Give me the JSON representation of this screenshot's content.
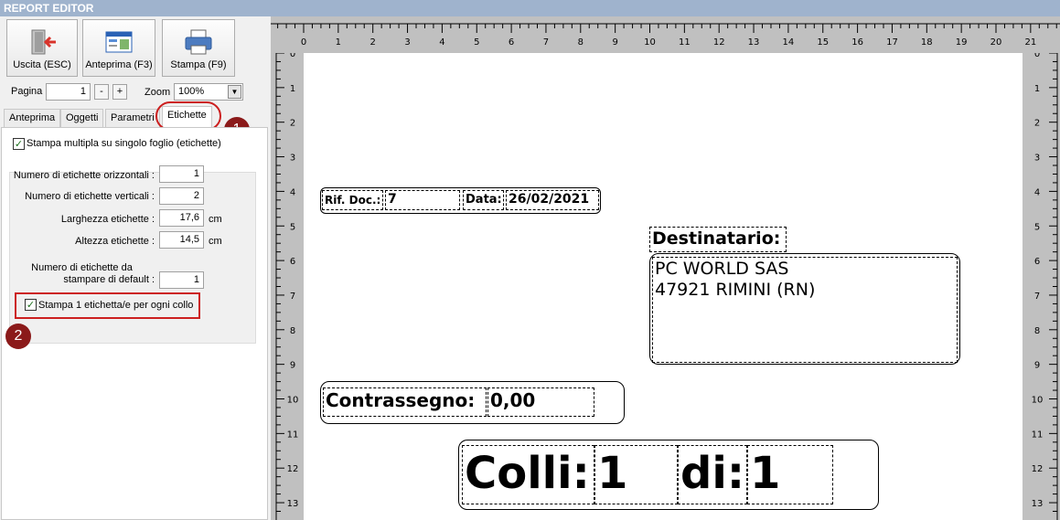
{
  "window": {
    "title": "REPORT EDITOR"
  },
  "toolbar": {
    "exit_label": "Uscita (ESC)",
    "preview_label": "Anteprima (F3)",
    "print_label": "Stampa (F9)"
  },
  "nav": {
    "page_label": "Pagina",
    "page_value": "1",
    "minus": "-",
    "plus": "+",
    "zoom_label": "Zoom",
    "zoom_value": "100%"
  },
  "tabs": [
    {
      "label": "Anteprima"
    },
    {
      "label": "Oggetti"
    },
    {
      "label": "Parametri"
    },
    {
      "label": "Etichette"
    }
  ],
  "etichette": {
    "multi_print_label": "Stampa multipla su singolo foglio (etichette)",
    "multi_print_checked": true,
    "horiz_label": "Numero di etichette orizzontali :",
    "horiz_value": "1",
    "vert_label": "Numero di etichette verticali :",
    "vert_value": "2",
    "width_label": "Larghezza etichette :",
    "width_value": "17,6",
    "width_unit": "cm",
    "height_label": "Altezza etichette :",
    "height_value": "14,5",
    "height_unit": "cm",
    "default_label_1": "Numero di etichette da",
    "default_label_2": "stampare di default :",
    "default_value": "1",
    "per_collo_label": "Stampa 1 etichetta/e per ogni collo",
    "per_collo_checked": true
  },
  "callouts": {
    "one": "1",
    "two": "2"
  },
  "ruler": {
    "top_numbers": [
      "0",
      "1",
      "2",
      "3",
      "4",
      "5",
      "6",
      "7",
      "8",
      "9",
      "10",
      "11",
      "12",
      "13",
      "14",
      "15",
      "16",
      "17",
      "18",
      "19",
      "20",
      "21"
    ],
    "left_numbers": [
      "0",
      "1",
      "2",
      "3",
      "4",
      "5",
      "6",
      "7",
      "8",
      "9",
      "10",
      "11",
      "12",
      "13"
    ]
  },
  "report": {
    "rif_label": "Rif. Doc.:",
    "rif_value": "7",
    "data_label": "Data:",
    "data_value": "26/02/2021",
    "dest_label": "Destinatario:",
    "dest_line1": "PC WORLD SAS",
    "dest_line2": "47921 RIMINI (RN)",
    "contr_label": "Contrassegno:",
    "contr_value": "0,00",
    "colli_label": "Colli:",
    "colli_value": "1",
    "di_label": "di:",
    "di_value": "1"
  }
}
